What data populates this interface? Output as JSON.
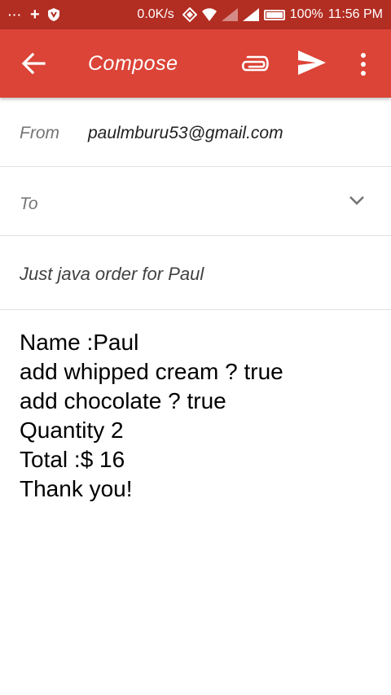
{
  "status_bar": {
    "left_icons": [
      "more-dots-icon",
      "plus-icon",
      "shield-icon"
    ],
    "dots": "···",
    "plus": "+",
    "speed": "0.0K/s",
    "battery": "100%",
    "time": "11:56 PM"
  },
  "appbar": {
    "title": "Compose",
    "color": "#db4437",
    "icons": [
      "back-arrow-icon",
      "paperclip-icon",
      "send-icon",
      "more-vert-icon"
    ]
  },
  "compose": {
    "from_label": "From",
    "from_value": "paulmburu53@gmail.com",
    "to_label": "To",
    "subject": "Just java order for Paul",
    "body_lines": [
      "Name :Paul",
      "add whipped cream ? true",
      "add chocolate ? true",
      "Quantity 2",
      "Total :$ 16",
      "Thank you!"
    ]
  }
}
